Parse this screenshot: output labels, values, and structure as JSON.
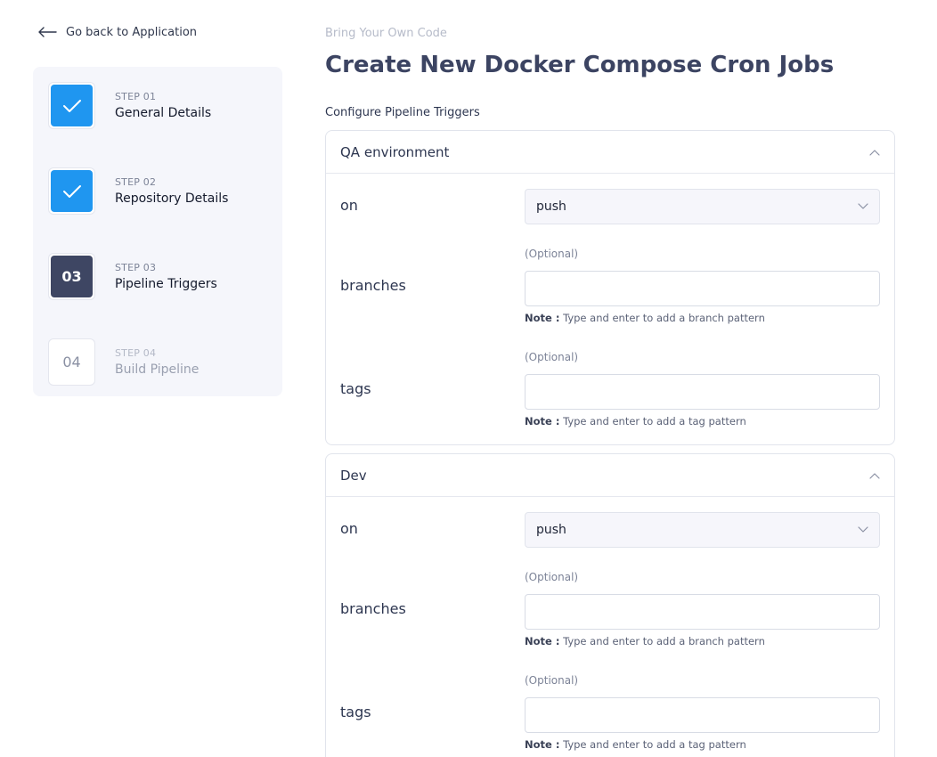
{
  "nav": {
    "back_label": "Go back to Application"
  },
  "steps": [
    {
      "kicker": "STEP 01",
      "title": "General Details",
      "badge": "",
      "state": "done"
    },
    {
      "kicker": "STEP 02",
      "title": "Repository Details",
      "badge": "",
      "state": "done"
    },
    {
      "kicker": "STEP 03",
      "title": "Pipeline Triggers",
      "badge": "03",
      "state": "current"
    },
    {
      "kicker": "STEP 04",
      "title": "Build Pipeline",
      "badge": "04",
      "state": "pending"
    }
  ],
  "header": {
    "kicker": "Bring Your Own Code",
    "title": "Create New Docker Compose Cron Jobs"
  },
  "section_label": "Configure Pipeline Triggers",
  "environments": [
    {
      "name": "QA environment",
      "on_label": "on",
      "on_value": "push",
      "branches_label": "branches",
      "branches_optional": "(Optional)",
      "branches_value": "",
      "branches_note_key": "Note :",
      "branches_note_text": "Type and enter to add a branch pattern",
      "tags_label": "tags",
      "tags_optional": "(Optional)",
      "tags_value": "",
      "tags_note_key": "Note :",
      "tags_note_text": "Type and enter to add a tag pattern"
    },
    {
      "name": "Dev",
      "on_label": "on",
      "on_value": "push",
      "branches_label": "branches",
      "branches_optional": "(Optional)",
      "branches_value": "",
      "branches_note_key": "Note :",
      "branches_note_text": "Type and enter to add a branch pattern",
      "tags_label": "tags",
      "tags_optional": "(Optional)",
      "tags_value": "",
      "tags_note_key": "Note :",
      "tags_note_text": "Type and enter to add a tag pattern"
    }
  ],
  "colors": {
    "accent": "#1f96f0",
    "current_step": "#3e4663",
    "title": "#3c4462",
    "panel_border": "#e1e4ec"
  },
  "icons": {
    "back": "arrow-left-icon",
    "done": "check-icon",
    "collapse": "chevron-up-icon",
    "dropdown": "chevron-down-icon"
  }
}
